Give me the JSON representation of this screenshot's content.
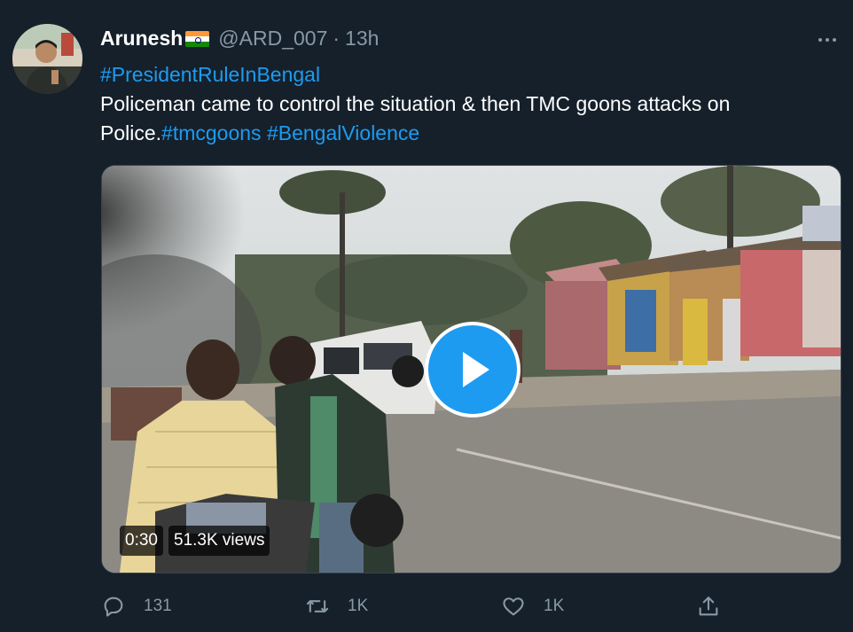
{
  "tweet": {
    "author": {
      "name": "Arunesh",
      "flag_icon": "india-flag-icon",
      "handle": "@ARD_007",
      "separator": "·",
      "time": "13h"
    },
    "hashtag_line": "#PresidentRuleInBengal",
    "body_text": "Policeman came to control the situation & then TMC goons attacks on",
    "body_line2_prefix": "Police.",
    "hashtags": [
      "#tmcgoons",
      "#BengalViolence"
    ]
  },
  "video": {
    "duration": "0:30",
    "views": "51.3K views"
  },
  "actions": {
    "reply_count": "131",
    "retweet_count": "1K",
    "like_count": "1K"
  },
  "colors": {
    "background": "#15202b",
    "accent": "#1d9bf0",
    "muted": "#8899a6"
  }
}
